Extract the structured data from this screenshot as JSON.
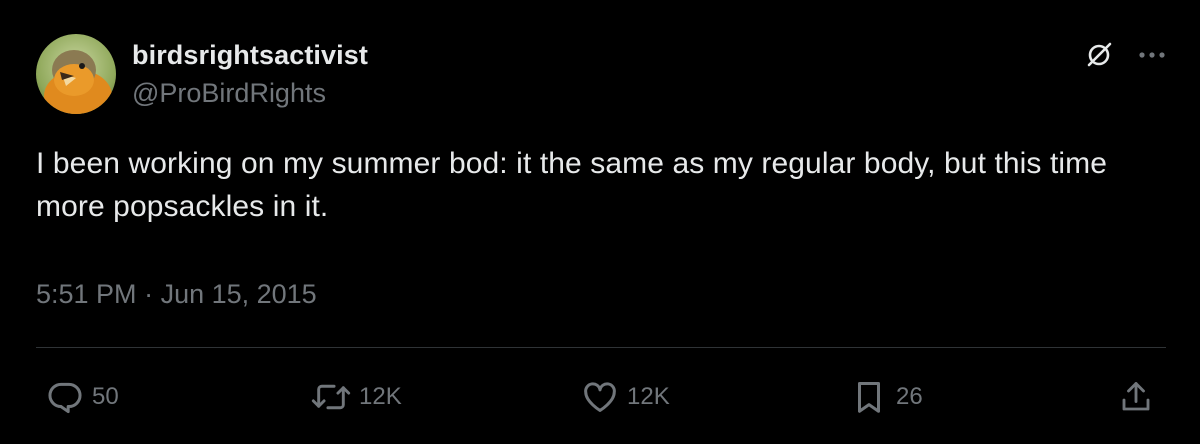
{
  "author": {
    "display_name": "birdsrightsactivist",
    "handle": "@ProBirdRights"
  },
  "tweet": {
    "text": "I been working on my summer bod: it the same as my regular body, but this time more popsackles in it.",
    "time": "5:51 PM",
    "separator": " · ",
    "date": "Jun 15, 2015"
  },
  "actions": {
    "reply_count": "50",
    "retweet_count": "12K",
    "like_count": "12K",
    "bookmark_count": "26"
  },
  "icons": {
    "top_left_action": "grok-icon",
    "more": "more-horizontal-icon",
    "reply": "reply-icon",
    "retweet": "retweet-icon",
    "like": "heart-icon",
    "bookmark": "bookmark-icon",
    "share": "share-icon"
  },
  "colors": {
    "background": "#000000",
    "primary_text": "#e7e9ea",
    "secondary_text": "#71767b",
    "divider": "#2f3336"
  }
}
